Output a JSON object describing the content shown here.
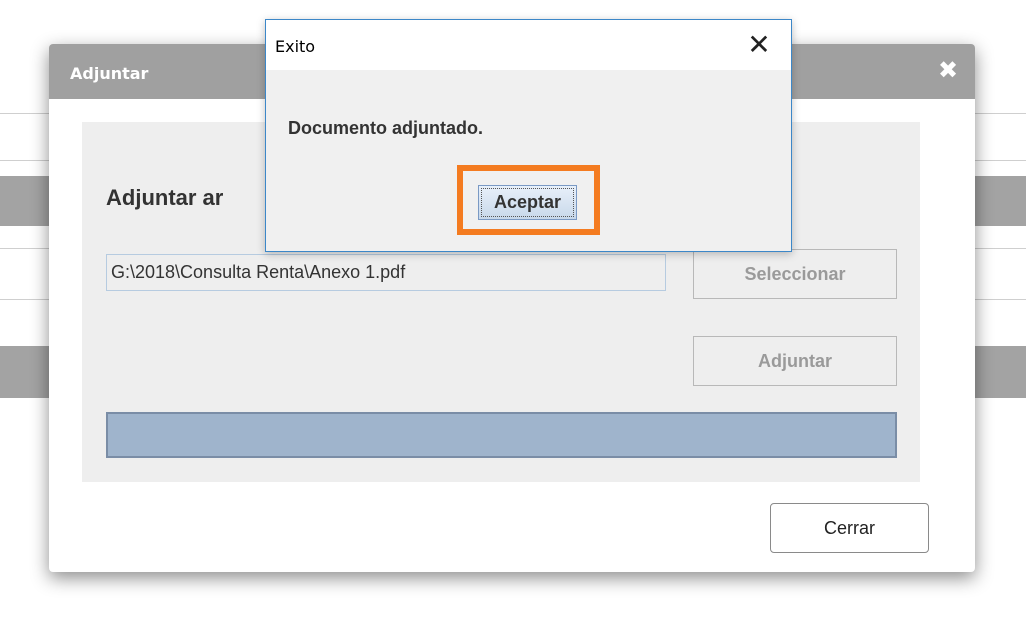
{
  "adjuntar_dialog": {
    "title": "Adjuntar",
    "close_glyph": "✖",
    "heading": "Adjuntar ar",
    "file_path": "G:\\2018\\Consulta Renta\\Anexo 1.pdf",
    "select_button": "Seleccionar",
    "attach_button": "Adjuntar",
    "close_button": "Cerrar",
    "progress": 1.0
  },
  "message_box": {
    "title": "Exito",
    "close_glyph": "✕",
    "message": "Documento adjuntado.",
    "ok_button": "Aceptar"
  },
  "colors": {
    "dialog_header": "#a0a0a0",
    "progress_fill": "#9fb4cc",
    "highlight": "#f47b20",
    "msgbox_border": "#3c87c8"
  },
  "icons": {
    "dialog_close": "close-icon",
    "msgbox_close": "close-icon"
  }
}
